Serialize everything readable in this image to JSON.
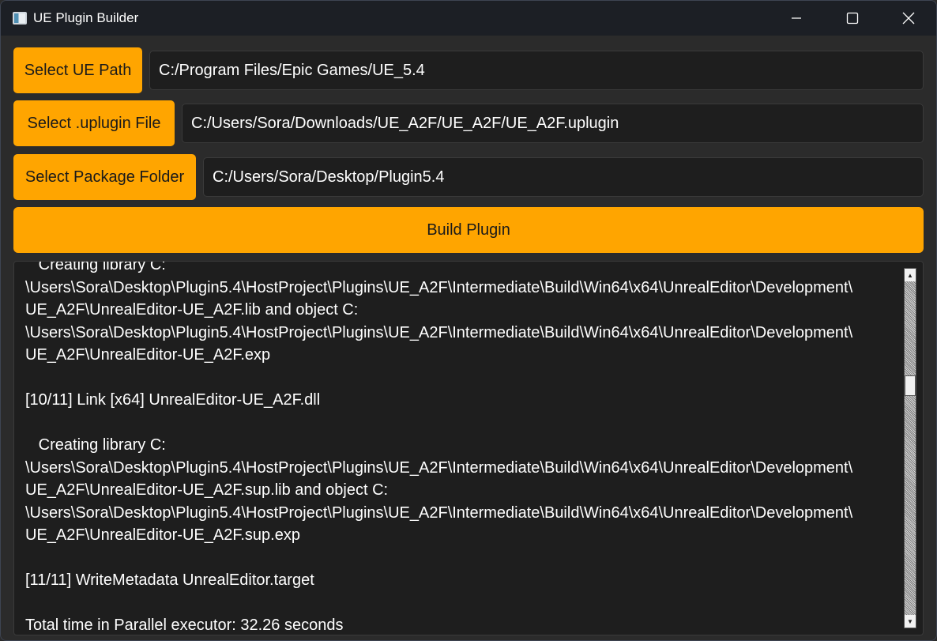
{
  "window": {
    "title": "UE Plugin Builder",
    "icon": "app-window-icon",
    "controls": [
      "minimize-icon",
      "maximize-icon",
      "close-icon"
    ]
  },
  "ue_path": {
    "button_label": "Select UE Path",
    "value": "C:/Program Files/Epic Games/UE_5.4"
  },
  "uplugin": {
    "button_label": "Select .uplugin File",
    "value": "C:/Users/Sora/Downloads/UE_A2F/UE_A2F/UE_A2F.uplugin"
  },
  "package_folder": {
    "button_label": "Select Package Folder",
    "value": "C:/Users/Sora/Desktop/Plugin5.4"
  },
  "build": {
    "button_label": "Build Plugin"
  },
  "log": {
    "text": "   Creating library C:\n\\Users\\Sora\\Desktop\\Plugin5.4\\HostProject\\Plugins\\UE_A2F\\Intermediate\\Build\\Win64\\x64\\UnrealEditor\\Development\\\nUE_A2F\\UnrealEditor-UE_A2F.lib and object C:\n\\Users\\Sora\\Desktop\\Plugin5.4\\HostProject\\Plugins\\UE_A2F\\Intermediate\\Build\\Win64\\x64\\UnrealEditor\\Development\\\nUE_A2F\\UnrealEditor-UE_A2F.exp\n\n[10/11] Link [x64] UnrealEditor-UE_A2F.dll\n\n   Creating library C:\n\\Users\\Sora\\Desktop\\Plugin5.4\\HostProject\\Plugins\\UE_A2F\\Intermediate\\Build\\Win64\\x64\\UnrealEditor\\Development\\\nUE_A2F\\UnrealEditor-UE_A2F.sup.lib and object C:\n\\Users\\Sora\\Desktop\\Plugin5.4\\HostProject\\Plugins\\UE_A2F\\Intermediate\\Build\\Win64\\x64\\UnrealEditor\\Development\\\nUE_A2F\\UnrealEditor-UE_A2F.sup.exp\n\n[11/11] WriteMetadata UnrealEditor.target\n\nTotal time in Parallel executor: 32.26 seconds"
  },
  "colors": {
    "accent": "#ffa500",
    "background": "#2b2b2b",
    "field_background": "#1e1e1e",
    "titlebar": "#1c1f25"
  }
}
